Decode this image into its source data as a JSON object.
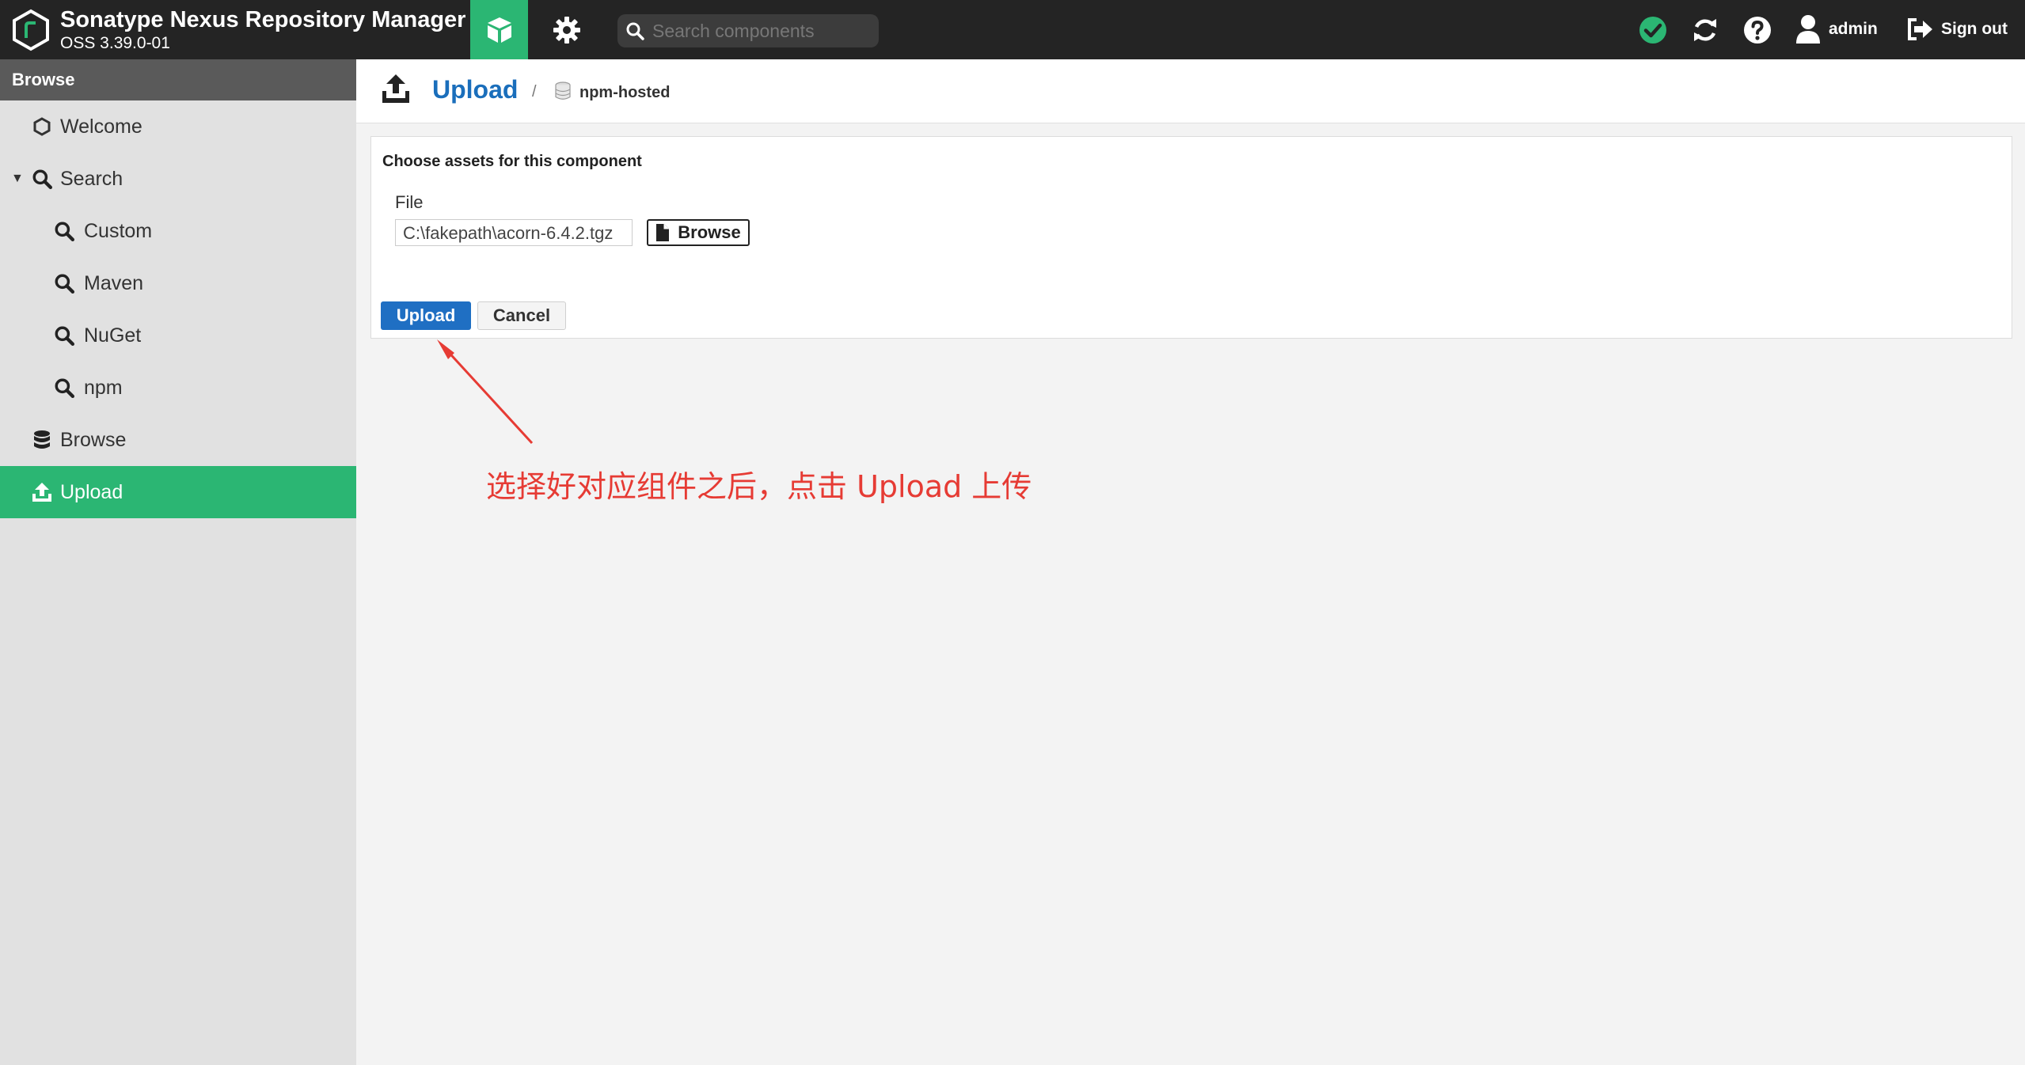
{
  "app": {
    "title": "Sonatype Nexus Repository Manager",
    "version": "OSS 3.39.0-01"
  },
  "header": {
    "search_placeholder": "Search components",
    "user": "admin",
    "sign_out": "Sign out",
    "status_color": "#2bb673"
  },
  "sidebar": {
    "heading": "Browse",
    "items": [
      {
        "label": "Welcome",
        "icon": "hexagon-icon"
      },
      {
        "label": "Search",
        "icon": "search-icon",
        "expanded": true
      },
      {
        "label": "Custom",
        "icon": "search-icon"
      },
      {
        "label": "Maven",
        "icon": "search-icon"
      },
      {
        "label": "NuGet",
        "icon": "search-icon"
      },
      {
        "label": "npm",
        "icon": "search-icon"
      },
      {
        "label": "Browse",
        "icon": "database-icon"
      },
      {
        "label": "Upload",
        "icon": "upload-icon",
        "active": true
      }
    ]
  },
  "breadcrumb": {
    "title": "Upload",
    "separator": "/",
    "repository": "npm-hosted"
  },
  "form": {
    "heading": "Choose assets for this component",
    "file_label": "File",
    "file_value": "C:\\fakepath\\acorn-6.4.2.tgz",
    "browse_label": "Browse",
    "upload_label": "Upload",
    "cancel_label": "Cancel"
  },
  "annotation": {
    "text": "选择好对应组件之后，点击 Upload 上传",
    "color": "#e63b34"
  },
  "colors": {
    "accent_green": "#2bb673",
    "primary_blue": "#1f6fc3",
    "header_bg": "#242424"
  }
}
